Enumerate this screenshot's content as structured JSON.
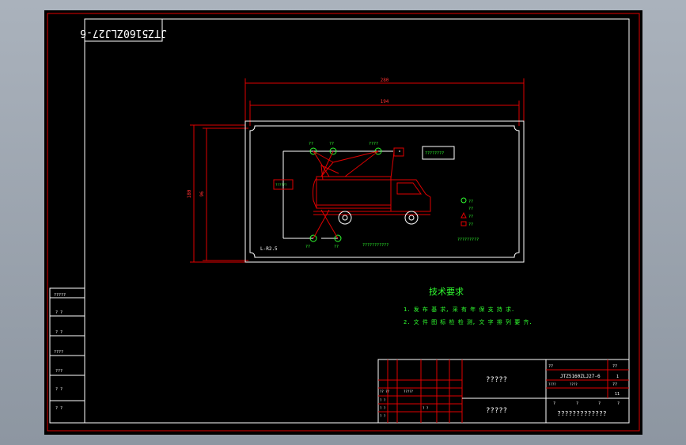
{
  "drawing_code": "JTZ5160ZLJ27-6",
  "dimensions": {
    "overall_width": "280",
    "inner_width": "194",
    "overall_height": "180",
    "inner_height": "96"
  },
  "panel_label": "L-R2.5",
  "component_labels": [
    "??",
    "??",
    "????",
    "??",
    "??"
  ],
  "box_label_left": "??????",
  "box_label_right": "????????",
  "bottom_note": "???????????",
  "legend_items": [
    "??",
    "??",
    "??",
    "??"
  ],
  "legend_note": "?????????",
  "tech_title": "技术要求",
  "tech_lines": [
    "1. 发 布 基 求, 采 有 年 保 支 持 求.",
    "2. 文 件 图 标 检 检 测, 文 字 排 列 要 齐."
  ],
  "left_table": [
    "?????",
    "? ?",
    "? ?",
    "????",
    "???",
    "? ?",
    "? ?"
  ],
  "title_block": {
    "cell_a": "?????",
    "cell_b": "?????",
    "code": "JTZ5160ZLJ27-6",
    "sig": "?????????????",
    "small": [
      "??",
      "??",
      "????",
      "????",
      "?",
      "?",
      "?",
      "?",
      "1",
      "11",
      "??"
    ],
    "grid_labels": [
      "?? ??",
      "?????",
      "? ?",
      "? ?",
      "? ?",
      "? ?"
    ]
  }
}
